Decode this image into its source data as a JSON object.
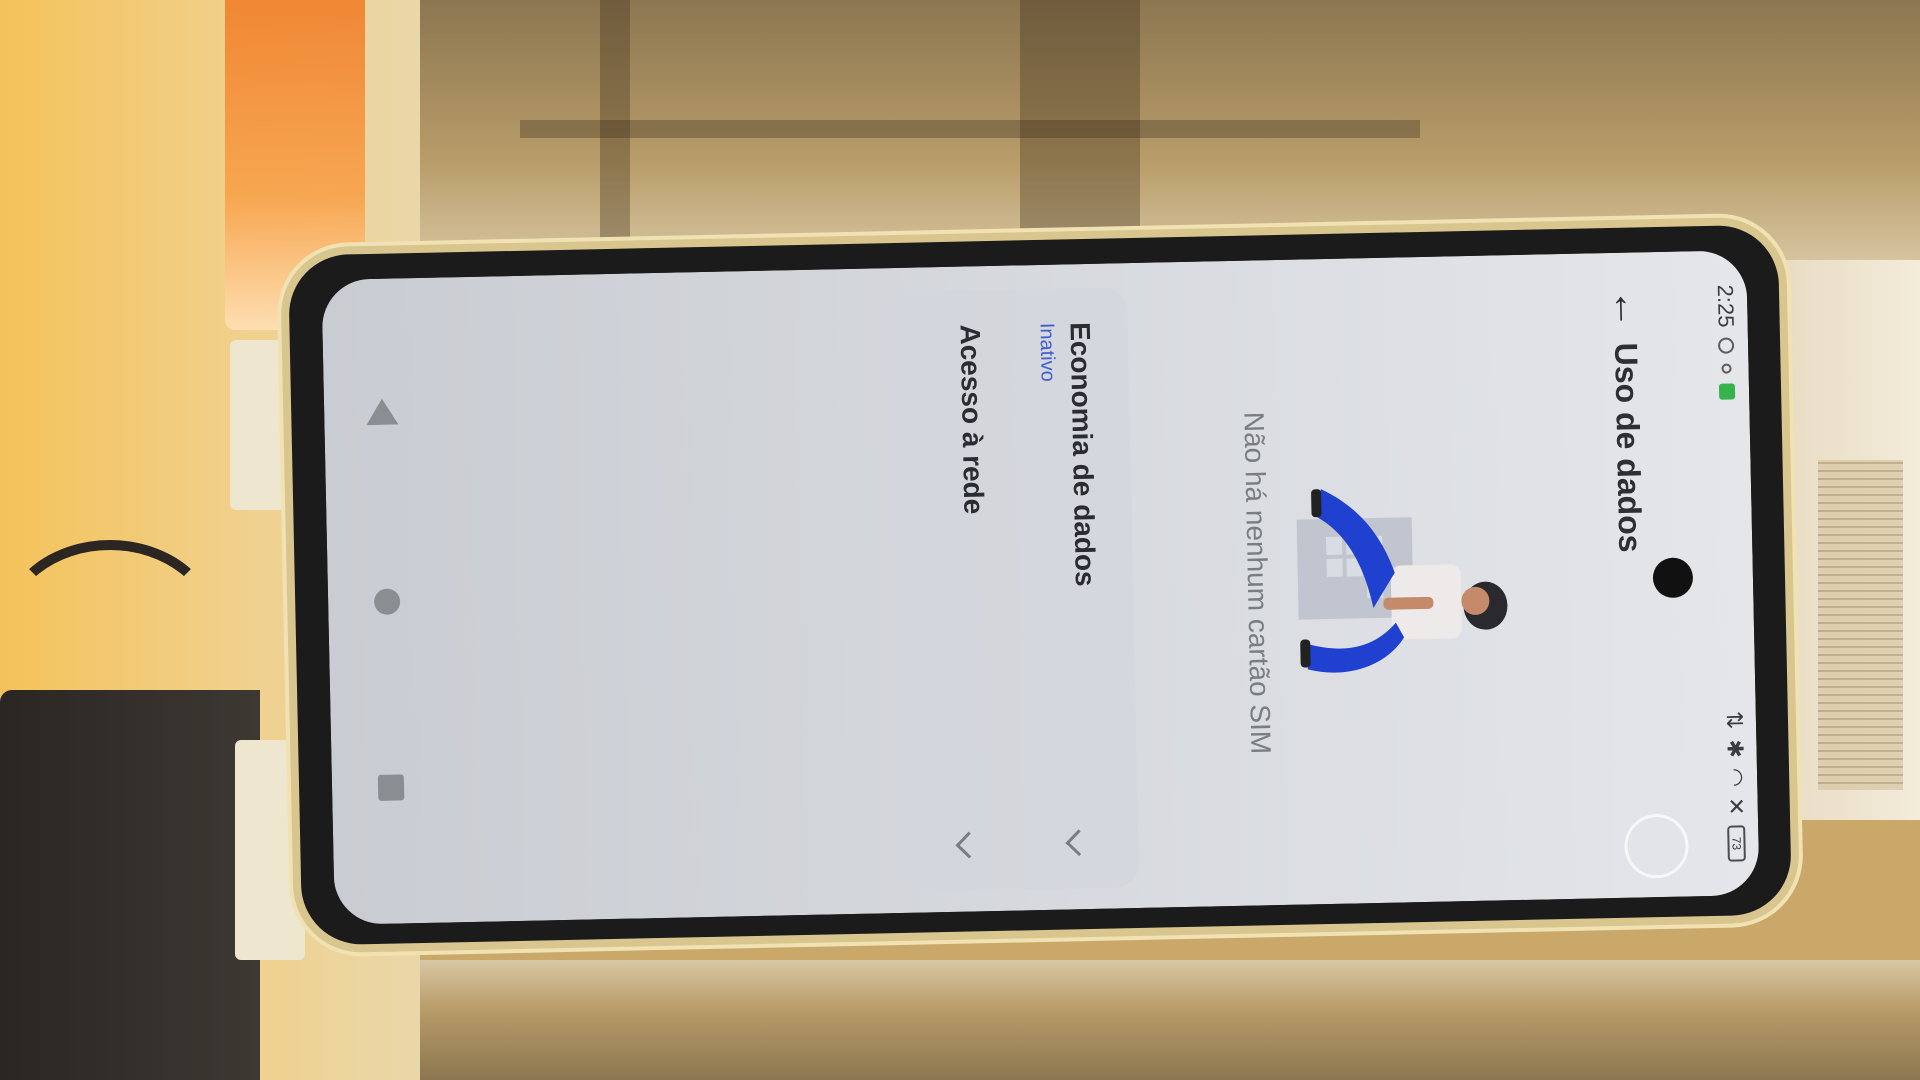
{
  "status_bar": {
    "time": "2:25",
    "battery": "73"
  },
  "app_bar": {
    "back_icon": "arrow-left-icon",
    "title": "Uso de dados"
  },
  "empty_state": {
    "illustration": "person-on-sim-card-illustration",
    "message": "Não há nenhum cartão SIM"
  },
  "settings": {
    "items": [
      {
        "label": "Economia de dados",
        "sublabel": "Inativo",
        "icon": "chevron-down-icon"
      },
      {
        "label": "Acesso à rede",
        "icon": "chevron-down-icon"
      }
    ]
  },
  "nav_bar": {
    "back_icon": "triangle-back-icon",
    "home_icon": "circle-home-icon",
    "recents_icon": "square-recents-icon"
  },
  "colors": {
    "accent": "#3f5fd0",
    "screen_bg": "#e4e6ea",
    "illustration_blue": "#2040d0"
  }
}
